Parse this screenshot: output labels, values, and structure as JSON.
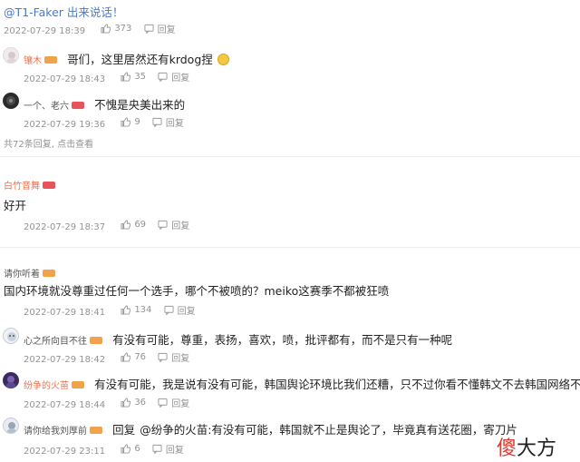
{
  "top": {
    "text": "@T1-Faker 出来说话！",
    "date": "2022-07-29 18:39",
    "likes": "373",
    "reply": "回复"
  },
  "sub_comments": [
    {
      "user": "镶木",
      "text": "哥们，这里居然还有krdog捏",
      "emoji": "smile-emoji",
      "date": "2022-07-29 18:43",
      "likes": "35",
      "reply": "回复"
    },
    {
      "user": "一个、老六",
      "text": "不愧是央美出来的",
      "date": "2022-07-29 19:36",
      "likes": "9",
      "reply": "回复"
    }
  ],
  "more_replies": "共72条回复, 点击查看",
  "comment2": {
    "user": "白竹音舞",
    "text": "好开",
    "date": "2022-07-29 18:37",
    "likes": "69",
    "reply": "回复"
  },
  "comment3": {
    "user": "请你听着",
    "text": "国内环境就没尊重过任何一个选手，哪个不被喷的？meiko这赛季不都被狂喷",
    "date": "2022-07-29 18:41",
    "likes": "134",
    "reply": "回复"
  },
  "sub_comments3": [
    {
      "user": "心之所向目不往",
      "text": "有没有可能，尊重，表扬，喜欢，喷，批评都有，而不是只有一种呢",
      "date": "2022-07-29 18:42",
      "likes": "76",
      "reply": "回复"
    },
    {
      "user": "纷争的火苗",
      "text": "有没有可能，我是说有没有可能，韩国舆论环境比我们还糟，只不过你看不懂韩文不去韩国网络不知道",
      "date": "2022-07-29 18:44",
      "likes": "36",
      "reply": "回复"
    },
    {
      "user": "请你给我刘厚前",
      "reply_word": "回复",
      "mention": "@纷争的火苗",
      "text": ":有没有可能，韩国就不止是舆论了，毕竟真有送花圈，寄刀片",
      "date": "2022-07-29 23:11",
      "likes": "6",
      "reply": "回复"
    }
  ],
  "watermark": {
    "char1": "傻",
    "char2": "大方",
    "color1": "#e03a2f",
    "color2": "#222222"
  }
}
